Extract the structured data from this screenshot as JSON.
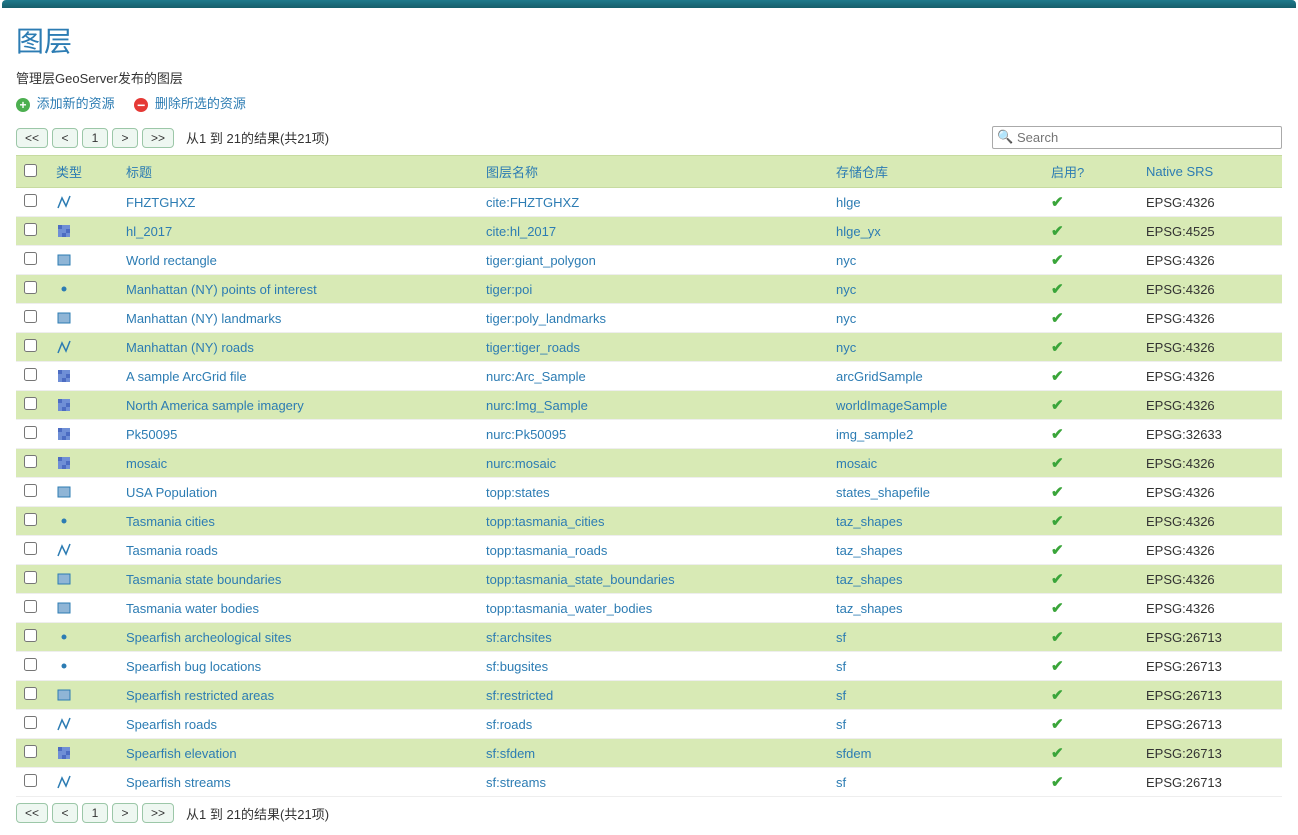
{
  "page": {
    "title": "图层",
    "subtitle": "管理层GeoServer发布的图层"
  },
  "actions": {
    "add": "添加新的资源",
    "remove": "删除所选的资源"
  },
  "pager": {
    "first": "<<",
    "prev": "<",
    "page": "1",
    "next": ">",
    "last": ">>",
    "info": "从1 到 21的结果(共21项)"
  },
  "search": {
    "placeholder": "Search"
  },
  "headers": {
    "type": "类型",
    "title": "标题",
    "name": "图层名称",
    "store": "存储仓库",
    "enabled": "启用?",
    "srs": "Native SRS"
  },
  "rows": [
    {
      "type": "line",
      "title": "FHZTGHXZ",
      "name": "cite:FHZTGHXZ",
      "store": "hlge",
      "srs": "EPSG:4326"
    },
    {
      "type": "raster",
      "title": "hl_2017",
      "name": "cite:hl_2017",
      "store": "hlge_yx",
      "srs": "EPSG:4525"
    },
    {
      "type": "poly",
      "title": "World rectangle",
      "name": "tiger:giant_polygon",
      "store": "nyc",
      "srs": "EPSG:4326"
    },
    {
      "type": "point",
      "title": "Manhattan (NY) points of interest",
      "name": "tiger:poi",
      "store": "nyc",
      "srs": "EPSG:4326"
    },
    {
      "type": "poly",
      "title": "Manhattan (NY) landmarks",
      "name": "tiger:poly_landmarks",
      "store": "nyc",
      "srs": "EPSG:4326"
    },
    {
      "type": "line",
      "title": "Manhattan (NY) roads",
      "name": "tiger:tiger_roads",
      "store": "nyc",
      "srs": "EPSG:4326"
    },
    {
      "type": "raster",
      "title": "A sample ArcGrid file",
      "name": "nurc:Arc_Sample",
      "store": "arcGridSample",
      "srs": "EPSG:4326"
    },
    {
      "type": "raster",
      "title": "North America sample imagery",
      "name": "nurc:Img_Sample",
      "store": "worldImageSample",
      "srs": "EPSG:4326"
    },
    {
      "type": "raster",
      "title": "Pk50095",
      "name": "nurc:Pk50095",
      "store": "img_sample2",
      "srs": "EPSG:32633"
    },
    {
      "type": "raster",
      "title": "mosaic",
      "name": "nurc:mosaic",
      "store": "mosaic",
      "srs": "EPSG:4326"
    },
    {
      "type": "poly",
      "title": "USA Population",
      "name": "topp:states",
      "store": "states_shapefile",
      "srs": "EPSG:4326"
    },
    {
      "type": "point",
      "title": "Tasmania cities",
      "name": "topp:tasmania_cities",
      "store": "taz_shapes",
      "srs": "EPSG:4326"
    },
    {
      "type": "line",
      "title": "Tasmania roads",
      "name": "topp:tasmania_roads",
      "store": "taz_shapes",
      "srs": "EPSG:4326"
    },
    {
      "type": "poly",
      "title": "Tasmania state boundaries",
      "name": "topp:tasmania_state_boundaries",
      "store": "taz_shapes",
      "srs": "EPSG:4326"
    },
    {
      "type": "poly",
      "title": "Tasmania water bodies",
      "name": "topp:tasmania_water_bodies",
      "store": "taz_shapes",
      "srs": "EPSG:4326"
    },
    {
      "type": "point",
      "title": "Spearfish archeological sites",
      "name": "sf:archsites",
      "store": "sf",
      "srs": "EPSG:26713"
    },
    {
      "type": "point",
      "title": "Spearfish bug locations",
      "name": "sf:bugsites",
      "store": "sf",
      "srs": "EPSG:26713"
    },
    {
      "type": "poly",
      "title": "Spearfish restricted areas",
      "name": "sf:restricted",
      "store": "sf",
      "srs": "EPSG:26713"
    },
    {
      "type": "line",
      "title": "Spearfish roads",
      "name": "sf:roads",
      "store": "sf",
      "srs": "EPSG:26713"
    },
    {
      "type": "raster",
      "title": "Spearfish elevation",
      "name": "sf:sfdem",
      "store": "sfdem",
      "srs": "EPSG:26713"
    },
    {
      "type": "line",
      "title": "Spearfish streams",
      "name": "sf:streams",
      "store": "sf",
      "srs": "EPSG:26713"
    }
  ]
}
